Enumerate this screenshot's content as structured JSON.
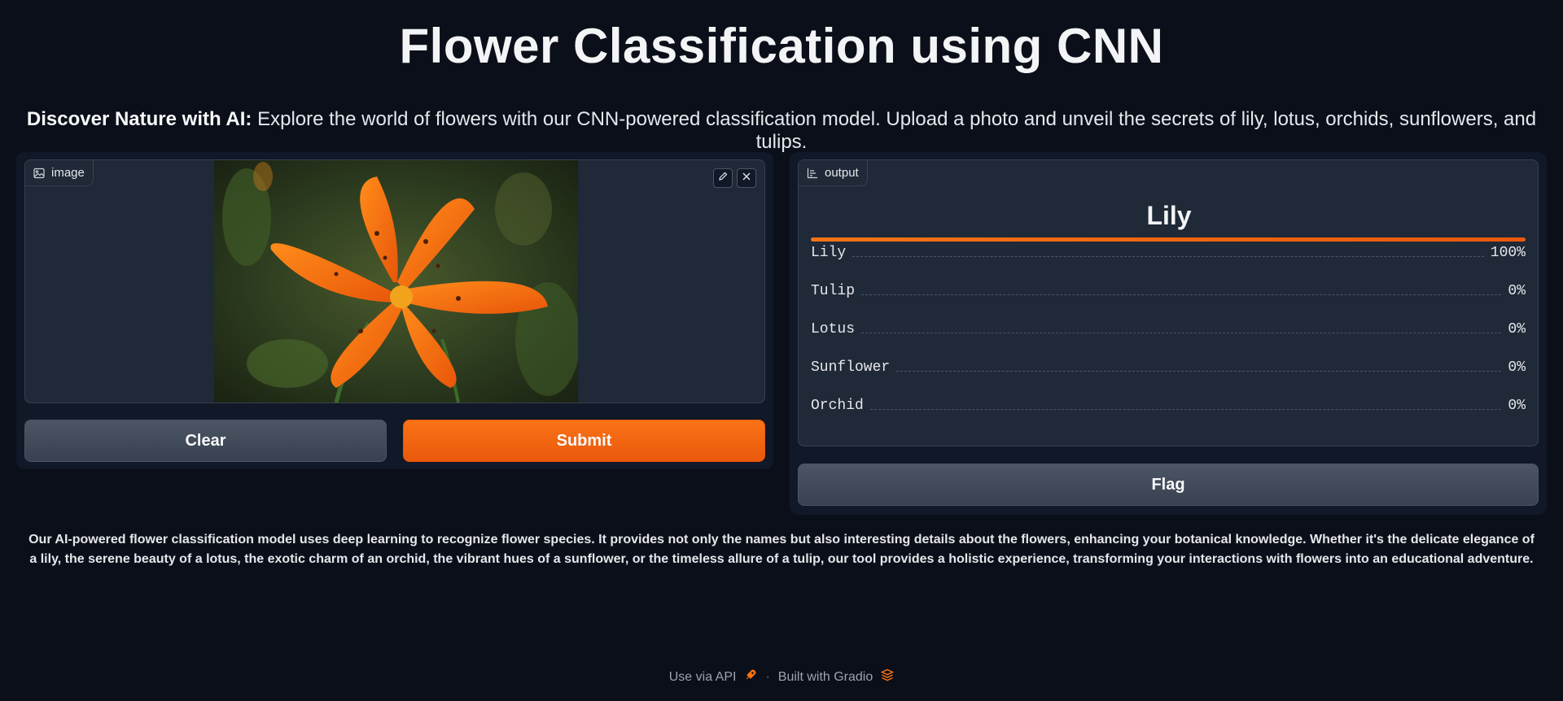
{
  "header": {
    "title": "Flower Classification using CNN",
    "subtitle_bold": "Discover Nature with AI:",
    "subtitle_rest": " Explore the world of flowers with our CNN-powered classification model. Upload a photo and unveil the secrets of lily, lotus, orchids, sunflowers, and tulips."
  },
  "input_panel": {
    "image_label": "image",
    "image_icon": "image-icon",
    "clear_label": "Clear",
    "submit_label": "Submit"
  },
  "output_panel": {
    "output_label": "output",
    "output_icon": "bar-chart-icon",
    "predicted_label": "Lily",
    "confidences": [
      {
        "label": "Lily",
        "value": "100%",
        "fraction": 1.0
      },
      {
        "label": "Tulip",
        "value": "0%",
        "fraction": 0.0
      },
      {
        "label": "Lotus",
        "value": "0%",
        "fraction": 0.0
      },
      {
        "label": "Sunflower",
        "value": "0%",
        "fraction": 0.0
      },
      {
        "label": "Orchid",
        "value": "0%",
        "fraction": 0.0
      }
    ],
    "flag_label": "Flag"
  },
  "description": "Our AI-powered flower classification model uses deep learning to recognize flower species. It provides not only the names but also interesting details about the flowers, enhancing your botanical knowledge. Whether it's the delicate elegance of a lily, the serene beauty of a lotus, the exotic charm of an orchid, the vibrant hues of a sunflower, or the timeless allure of a tulip, our tool provides a holistic experience, transforming your interactions with flowers into an educational adventure.",
  "footer": {
    "api_label": "Use via API",
    "separator": "·",
    "built_label": "Built with Gradio"
  },
  "colors": {
    "background": "#0b0f19",
    "panel": "#111827",
    "block": "#1f2937",
    "accent": "#f97316",
    "secondary_button": "#4b5563"
  }
}
